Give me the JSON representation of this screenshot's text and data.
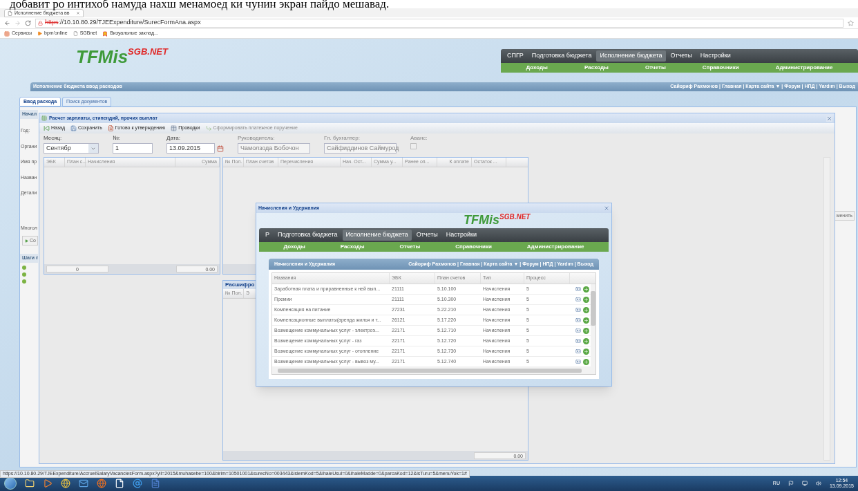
{
  "caption": "добавит   ро интихоб намуда нахш менамоед ки чунин экран пайдо мешавад.",
  "browser": {
    "tab": "Исполнение бюджета вв",
    "url_scheme": "https",
    "url_rest": "://10.10.80.29/TJEExpenditure/SurecFormAna.aspx",
    "bookmarks": [
      {
        "kind": "apps",
        "label": "Сервисы"
      },
      {
        "kind": "arrow",
        "label": "bpm'online"
      },
      {
        "kind": "page",
        "label": "SGBnet"
      },
      {
        "kind": "flag",
        "label": "Визуальные заклад..."
      }
    ]
  },
  "site": {
    "logo": {
      "main": "TFMis",
      "sup": "SGB.NET"
    },
    "menu": [
      {
        "label": "СПГР",
        "selected": false
      },
      {
        "label": "Подготовка бюджета",
        "selected": false
      },
      {
        "label": "Исполнение бюджета",
        "selected": true
      },
      {
        "label": "Отчеты",
        "selected": false
      },
      {
        "label": "Настройки",
        "selected": false
      }
    ],
    "submenu": [
      "Доходы",
      "Расходы",
      "Отчеты",
      "Справочники",
      "Администрирование"
    ],
    "page_title": "Исполнение бюджета ввод расходов",
    "user_links": "Сайориф Рахмонов | Главная  | Карта сайта ▼ | Форум | НПД | Yardım | Выход"
  },
  "tabs": [
    {
      "label": "Ввод расхода",
      "selected": true
    },
    {
      "label": "Поиск документов",
      "selected": false
    }
  ],
  "back_form": {
    "header": "Начал",
    "labels": [
      "Год:",
      "Органи",
      "Имя пр",
      "Назван",
      "Детали",
      "Многол"
    ],
    "button": "Со",
    "steps_header": "Шаги п",
    "right_button": "менить"
  },
  "salary_window": {
    "title": "Расчет зарплаты, стипендий, прочих выплат",
    "toolbar": [
      {
        "kind": "back",
        "label": "Назад",
        "disabled": false
      },
      {
        "kind": "save",
        "label": "Сохранить",
        "disabled": false
      },
      {
        "kind": "ready",
        "label": "Готово к утверждению",
        "disabled": false
      },
      {
        "kind": "postings",
        "label": "Проводки",
        "disabled": false
      },
      {
        "kind": "payment",
        "label": "Сформировать платежное поручение",
        "disabled": true
      }
    ],
    "fields": [
      {
        "kind": "select",
        "label": "Месяц:",
        "value": "Сентябр",
        "disabled": false
      },
      {
        "kind": "text",
        "label": "№:",
        "value": "1",
        "disabled": false
      },
      {
        "kind": "date",
        "label": "Дата:",
        "value": "13.09.2015",
        "disabled": false
      },
      {
        "kind": "text",
        "label": "Руководитель:",
        "value": "Чамолзода Бобочон",
        "disabled": true
      },
      {
        "kind": "text",
        "label": "Гл. бухгалтер:",
        "value": "Сайфиддинов Саймурод",
        "disabled": true
      },
      {
        "kind": "checkbox",
        "label": "Аванс:",
        "checked": false,
        "disabled": true
      }
    ],
    "left_grid": {
      "columns": [
        "ЭБК",
        "План с...",
        "Начисления",
        "Сумма"
      ],
      "footer": [
        "0",
        "0.00"
      ]
    },
    "right_grid": {
      "columns": [
        "№ Пол.",
        "План счетов",
        "Перечисления",
        "Нач. Ост...",
        "Сумма у...",
        "Ранее оп...",
        "К оплате",
        "Остаток ..."
      ]
    },
    "detail_panel": {
      "title": "Расшифро",
      "columns": [
        "№ Пол.",
        "Э"
      ],
      "footer": "0.00"
    }
  },
  "dialog": {
    "title": "Начисления и Удержания",
    "menu": [
      {
        "label": "Р",
        "selected": false
      },
      {
        "label": "Подготовка бюджета",
        "selected": false
      },
      {
        "label": "Исполнение бюджета",
        "selected": true
      },
      {
        "label": "Отчеты",
        "selected": false
      },
      {
        "label": "Настройки",
        "selected": false
      }
    ],
    "submenu": [
      "Доходы",
      "Расходы",
      "Отчеты",
      "Справочники",
      "Администрирование"
    ],
    "logo": {
      "main": "TFMis",
      "sup": "SGB.NET"
    },
    "bar_title": "Начисления и Удержания",
    "user_links": "Сайориф Рахмонов | Главная  | Карта сайта ▼ | Форум | НПД | Yardım | Выход",
    "columns": [
      "Названия",
      "ЭБК",
      "План счетов",
      "Тип",
      "Процесс"
    ],
    "rows": [
      [
        "Заработная плата и приравненные к ней вып...",
        "21111",
        "5.10.100",
        "Начисления",
        "5"
      ],
      [
        "Премии",
        "21111",
        "5.10.300",
        "Начисления",
        "5"
      ],
      [
        "Компенсация на питание",
        "27231",
        "5.22.210",
        "Начисления",
        "5"
      ],
      [
        "Компенсационные выплаты(аренда жилья и т...",
        "26121",
        "5.17.220",
        "Начисления",
        "5"
      ],
      [
        "Возмещение коммунальных услуг - электроэ...",
        "22171",
        "5.12.710",
        "Начисления",
        "5"
      ],
      [
        "Возмещение коммунальных услуг - газ",
        "22171",
        "5.12.720",
        "Начисления",
        "5"
      ],
      [
        "Возмещение коммунальных услуг - отопление",
        "22171",
        "5.12.730",
        "Начисления",
        "5"
      ],
      [
        "Возмещение коммунальных услуг - вывоз му...",
        "22171",
        "5.12.740",
        "Начисления",
        "5"
      ]
    ]
  },
  "status_url": "https://10.10.80.29/TJEExpenditure/AccruelSalaryVacanciesForm.aspx?yil=2015&muhasebe=100&birim=10501001&surecNo=003443&islemKod=5&ihaleUsul=0&ihaleMadde=0&parcaKod=12&isTuru=5&menuYok=1#",
  "taskbar": {
    "language": "RU",
    "time": "12:54",
    "date": "13.09.2015"
  }
}
